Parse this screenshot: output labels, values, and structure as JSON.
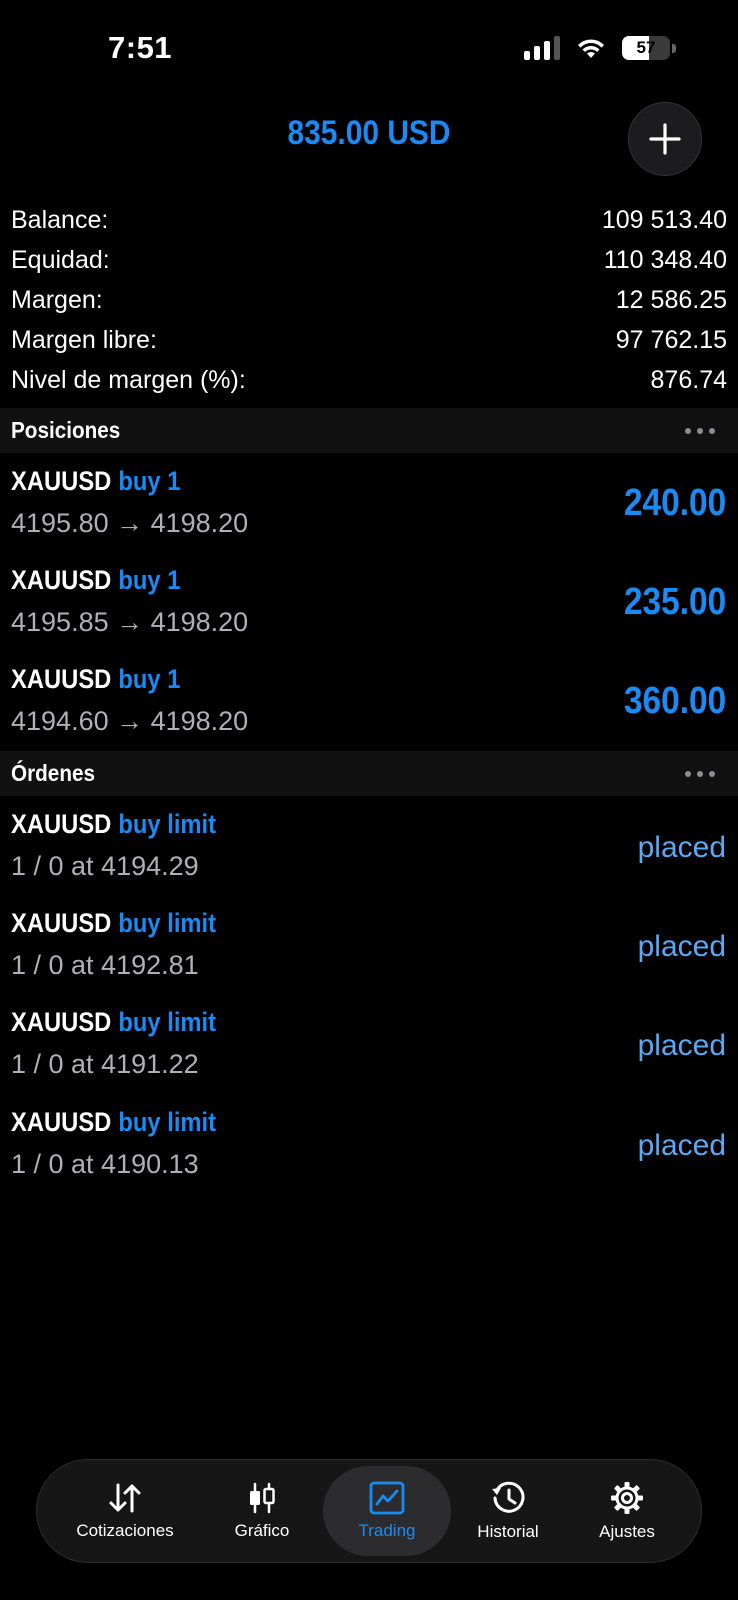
{
  "status": {
    "time": "7:51",
    "battery": "57",
    "battery_level": 0.57
  },
  "header": {
    "total": "835.00 USD"
  },
  "account": [
    {
      "label": "Balance:",
      "value": "109 513.40"
    },
    {
      "label": "Equidad:",
      "value": "110 348.40"
    },
    {
      "label": "Margen:",
      "value": "12 586.25"
    },
    {
      "label": "Margen libre:",
      "value": "97 762.15"
    },
    {
      "label": "Nivel de margen (%):",
      "value": "876.74"
    }
  ],
  "positions": {
    "title": "Posiciones",
    "items": [
      {
        "symbol": "XAUUSD",
        "type": "buy 1",
        "prices": "4195.80 → 4198.20",
        "profit": "240.00"
      },
      {
        "symbol": "XAUUSD",
        "type": "buy 1",
        "prices": "4195.85 → 4198.20",
        "profit": "235.00"
      },
      {
        "symbol": "XAUUSD",
        "type": "buy 1",
        "prices": "4194.60 → 4198.20",
        "profit": "360.00"
      }
    ]
  },
  "orders": {
    "title": "Órdenes",
    "items": [
      {
        "symbol": "XAUUSD",
        "type": "buy limit",
        "detail": "1 / 0 at 4194.29",
        "state": "placed"
      },
      {
        "symbol": "XAUUSD",
        "type": "buy limit",
        "detail": "1 / 0 at 4192.81",
        "state": "placed"
      },
      {
        "symbol": "XAUUSD",
        "type": "buy limit",
        "detail": "1 / 0 at 4191.22",
        "state": "placed"
      },
      {
        "symbol": "XAUUSD",
        "type": "buy limit",
        "detail": "1 / 0 at 4190.13",
        "state": "placed"
      }
    ]
  },
  "tabs": [
    {
      "label": "Cotizaciones",
      "icon": "arrows-updown-icon"
    },
    {
      "label": "Gráfico",
      "icon": "candlestick-icon"
    },
    {
      "label": "Trading",
      "icon": "trading-chart-icon",
      "active": true
    },
    {
      "label": "Historial",
      "icon": "history-icon"
    },
    {
      "label": "Ajustes",
      "icon": "gear-icon"
    }
  ],
  "colors": {
    "accent": "#1a8bf5",
    "background": "#000000",
    "section": "#111111"
  }
}
